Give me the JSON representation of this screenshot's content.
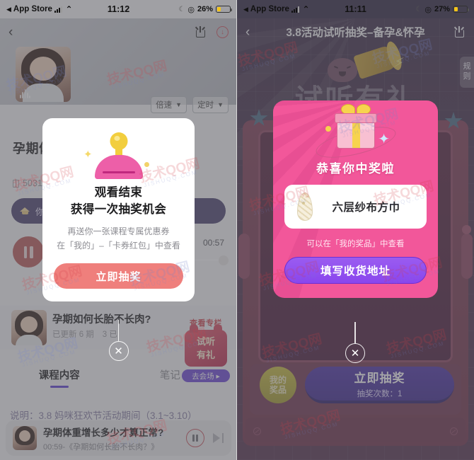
{
  "left": {
    "status": {
      "carrier": "App Store",
      "time": "11:12",
      "battery": "26%"
    },
    "nav": {
      "back": "‹",
      "share_icon": "share-icon",
      "download_icon": "download-icon"
    },
    "speed_pill": "倍速",
    "timer_pill": "定时",
    "course_title": "孕期体",
    "play_count": "5031",
    "banner_text": "你可",
    "elapsed": "00:57",
    "lesson": {
      "title": "孕期如何长胎不长肉?",
      "updated": "已更新 6 期",
      "extra": "3 已"
    },
    "promo": {
      "top": "查看专栏",
      "line1": "试听",
      "line2": "有礼",
      "button": "去会场 ▸"
    },
    "tabs": [
      {
        "label": "课程内容",
        "active": true
      },
      {
        "label": "笔记 (0)",
        "active": false
      }
    ],
    "description": "说明：3.8 妈咪狂欢节活动期间（3.1~3.10）",
    "player": {
      "title": "孕期体重增长多少才算正常?",
      "subtitle": "00:59-《孕期如何长胎不长肉？》",
      "pause_icon": "pause-icon",
      "next_icon": "next-track-icon"
    },
    "modal": {
      "icon": "lottery-lever-icon",
      "heading_line1": "观看结束",
      "heading_line2": "获得一次抽奖机会",
      "sub_line1": "再送你一张课程专属优惠券",
      "sub_line2": "在「我的」–「卡券红包」中查看",
      "button": "立即抽奖",
      "close": "✕"
    }
  },
  "right": {
    "status": {
      "carrier": "App Store",
      "time": "11:11",
      "battery": "27%"
    },
    "nav": {
      "back": "‹",
      "title": "3.8活动试听抽奖–备孕&怀孕",
      "share_icon": "share-icon"
    },
    "rules_tab": "规则",
    "hero_text": "试听有礼",
    "machine": {
      "prize_button_line1": "我的",
      "prize_button_line2": "奖品",
      "draw_button_title": "立即抽奖",
      "draw_button_sub": "抽奖次数：1"
    },
    "modal": {
      "icon": "gift-box-icon",
      "heading": "恭喜你中奖啦",
      "prize_icon": "gauze-towel-icon",
      "prize_name": "六层纱布方巾",
      "sub": "可以在「我的奖品」中查看",
      "button": "填写收货地址",
      "close": "✕"
    }
  },
  "watermark": {
    "cn": "技术QQ网",
    "en": "JISHUQQ.COM"
  },
  "colors": {
    "left_modal_button": "#ef7f7c",
    "right_modal_bg": "#ee5295",
    "right_modal_button": "#8a46ee",
    "accent_purple": "#5b3fd4",
    "machine_body": "#7e3b54"
  }
}
